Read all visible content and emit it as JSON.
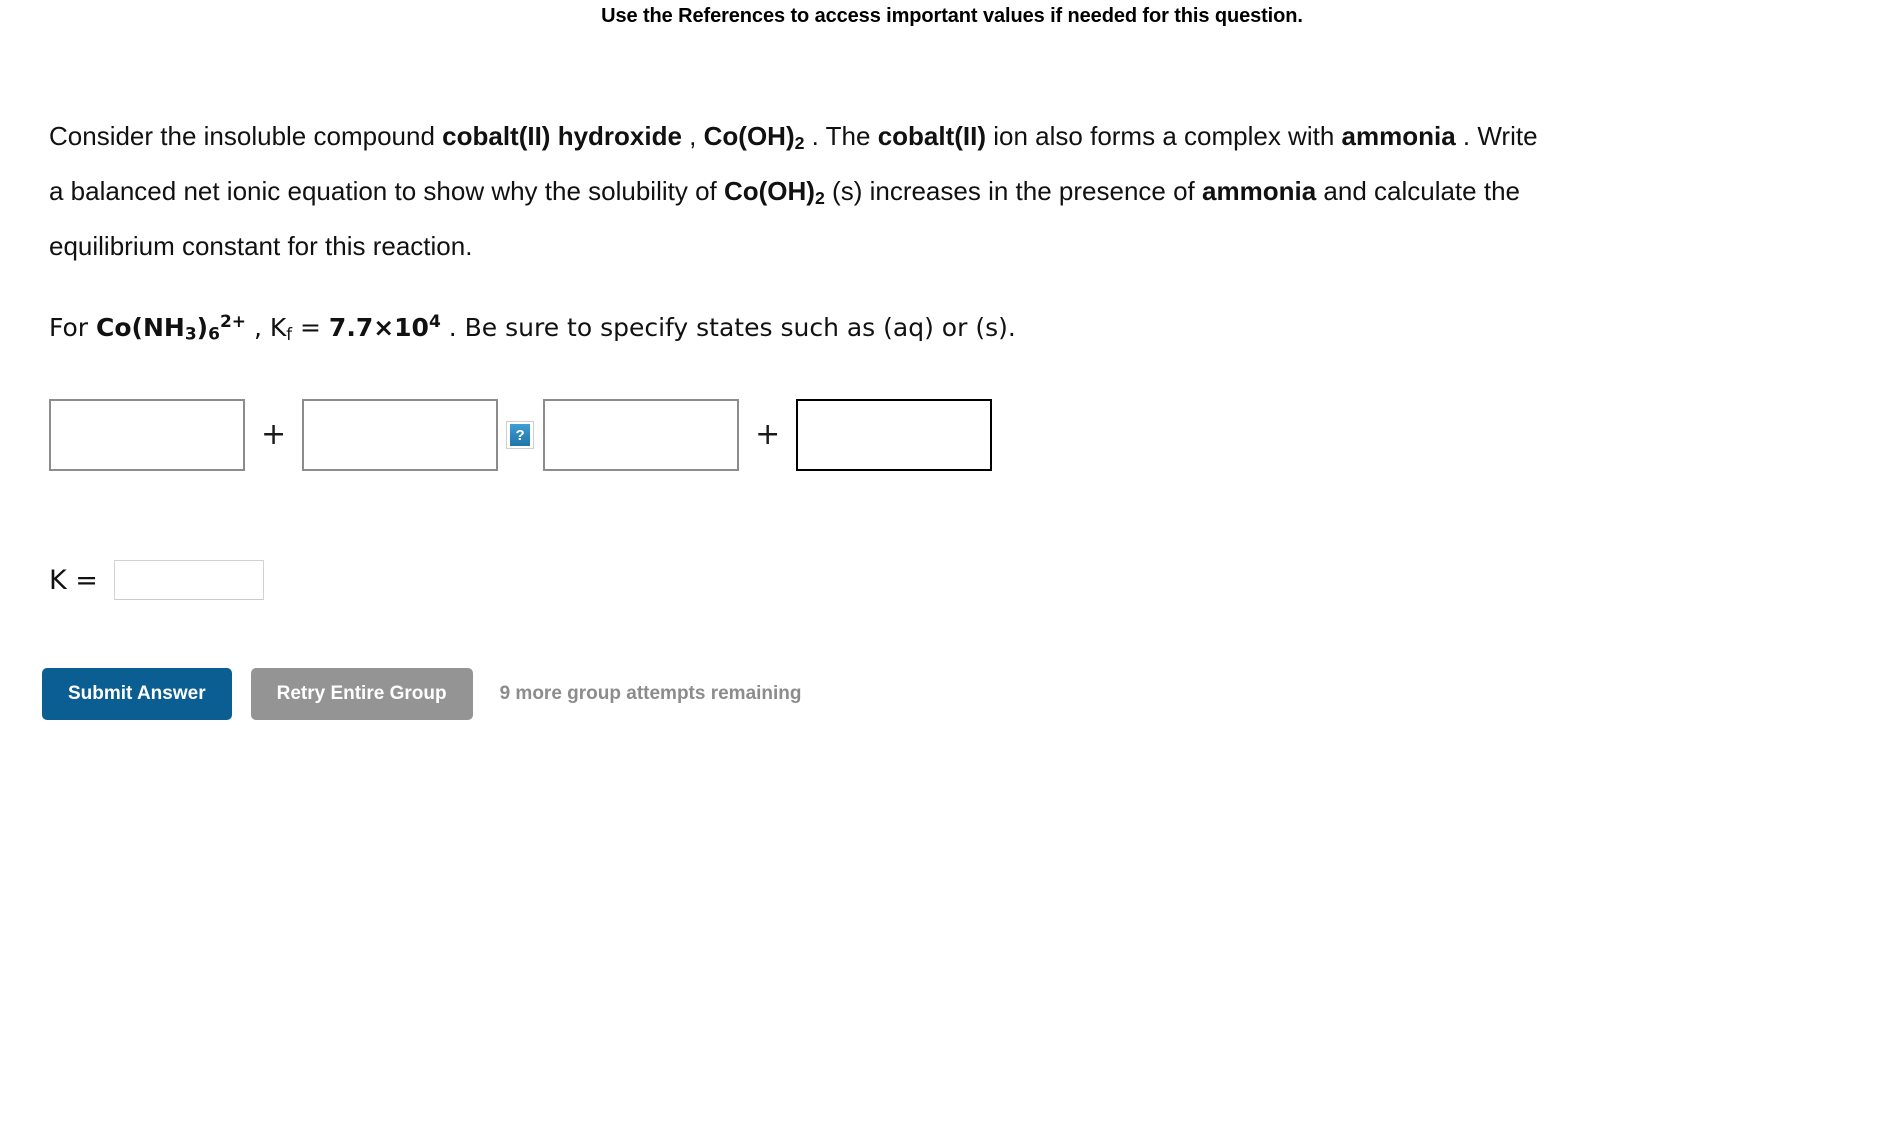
{
  "header": {
    "references_note": "Use the References to access important values if needed for this question."
  },
  "question": {
    "line1_pre": "Consider the insoluble compound ",
    "compound_name": "cobalt(II) hydroxide",
    "line1_mid": " , ",
    "formula_base": "Co(OH)",
    "formula_sub": "2",
    "line1_post": " . The ",
    "ion_name": "cobalt(II)",
    "line1_end": " ion also forms a complex with",
    "ligand_name": "ammonia",
    "line2_text": " . Write a balanced net ionic equation to show why the solubility of ",
    "line2_end": " (s) increases in the presence of",
    "line3_text": " and calculate the equilibrium constant for this reaction."
  },
  "kf_line": {
    "for_label": "For ",
    "complex_base": "Co(NH",
    "complex_sub1": "3",
    "complex_mid": ")",
    "complex_sub2": "6",
    "complex_charge": "2+",
    "comma": " , ",
    "kf_symbol": "K",
    "kf_subscript": "f",
    "equals": " = ",
    "kf_mantissa": "7.7×10",
    "kf_exponent": "4",
    "tail": " . Be sure to specify states such as (aq) or (s)."
  },
  "equation": {
    "plus1": "+",
    "plus2": "+",
    "help_glyph": "?",
    "help_label": "help",
    "reactant1_value": "",
    "reactant2_value": "",
    "product1_value": "",
    "product2_value": "",
    "input_placeholder": ""
  },
  "k_field": {
    "label": "K =",
    "value": "",
    "placeholder": ""
  },
  "actions": {
    "submit_label": "Submit Answer",
    "retry_label": "Retry Entire Group",
    "attempts_text": "9 more group attempts remaining"
  },
  "colors": {
    "submit_blue": "#0a5e92",
    "retry_gray": "#949494",
    "help_blue": "#2d86bb",
    "attempts_gray": "#8c8c8c",
    "box_border_gray": "#8c8c8c",
    "box_border_focus": "#000000"
  }
}
